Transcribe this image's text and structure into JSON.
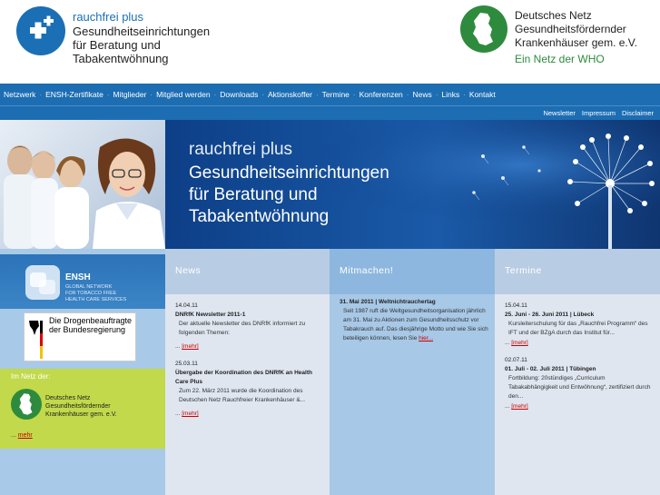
{
  "header": {
    "left_logo": {
      "title": "rauchfrei plus",
      "subtitle_lines": [
        "Gesundheitseinrichtungen",
        "für Beratung und",
        "Tabakentwöhnung"
      ]
    },
    "right_logo": {
      "lines": [
        "Deutsches Netz",
        "Gesundheitsfördernder",
        "Krankenhäuser gem. e.V."
      ],
      "tagline": "Ein Netz der WHO"
    }
  },
  "nav": {
    "items": [
      "Netzwerk",
      "ENSH-Zertifikate",
      "Mitglieder",
      "Mitglied werden",
      "Downloads",
      "Aktionskoffer",
      "Termine",
      "Konferenzen",
      "News",
      "Links",
      "Kontakt"
    ],
    "separator": "·"
  },
  "subnav": {
    "items": [
      "Newsletter",
      "Impressum",
      "Disclaimer"
    ]
  },
  "hero": {
    "line1": "rauchfrei plus",
    "line2": [
      "Gesundheitseinrichtungen",
      "für Beratung und",
      "Tabakentwöhnung"
    ]
  },
  "sidebar": {
    "ensh": {
      "name": "ENSH",
      "sub_lines": [
        "GLOBAL NETWORK",
        "FOR TOBACCO FREE",
        "HEALTH CARE SERVICES"
      ]
    },
    "drogen": {
      "lines": [
        "Die Drogenbeauftragte",
        "der Bundesregierung"
      ]
    },
    "imnetz": {
      "title": "Im Netz der:",
      "lines": [
        "Deutsches Netz",
        "Gesundheitsfördernder",
        "Krankenhäuser gem. e.V."
      ],
      "more_prefix": "...",
      "more_link": "mehr"
    }
  },
  "news": {
    "heading": "News",
    "entries": [
      {
        "date": "14.04.11",
        "title": "DNRfK Newsletter 2011-1",
        "text": "Der aktuelle Newsletter des DNRfK informiert zu folgenden Themen:",
        "more_prefix": "...",
        "more_link": "[mehr]"
      },
      {
        "date": "25.03.11",
        "title": "Übergabe der Koordination des DNRfK an Health Care Plus",
        "text": "Zum 22. März 2011 wurde die Koordination des Deutschen Netz Rauchfreier Krankenhäuser &...",
        "more_prefix": "...",
        "more_link": "[mehr]"
      }
    ]
  },
  "mitmachen": {
    "heading": "Mitmachen!",
    "entries": [
      {
        "title": "31. Mai 2011 | Weltnichtrauchertag",
        "text": "Seit 1987 ruft die Weltgesundheitsorganisation jährlich am 31. Mai zu Aktionen zum Gesundheitsschutz vor Tabakrauch auf. Das diesjährige Motto und wie Sie sich beteiligen können, lesen Sie",
        "link": "hier..."
      }
    ]
  },
  "termine": {
    "heading": "Termine",
    "entries": [
      {
        "date": "15.04.11",
        "title": "25. Juni - 26. Juni 2011 | Lübeck",
        "text": "Kursleiterschulung für das „Rauchfrei Programm“ des IFT und der BZgA durch das Institut für...",
        "more_prefix": "...",
        "more_link": "[mehr]"
      },
      {
        "date": "02.07.11",
        "title": "01. Juli - 02. Juli 2011 | Tübingen",
        "text": "Fortbildung: 20stündiges „Curriculum Tabakabhängigkeit und Entwöhnung“, zertifiziert durch den...",
        "more_prefix": "...",
        "more_link": "[mehr]"
      }
    ]
  },
  "colors": {
    "brand_blue": "#1d6db3",
    "green": "#2e8b3e",
    "lime": "#c1d94a",
    "link_red": "#cc0000"
  }
}
